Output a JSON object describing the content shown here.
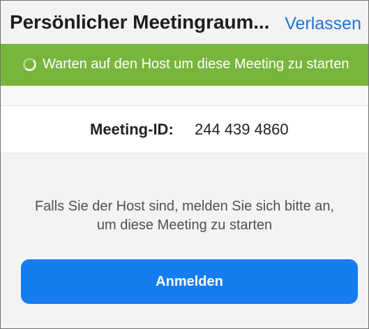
{
  "header": {
    "title": "Persönlicher Meetingraum...",
    "leave_label": "Verlassen"
  },
  "status_banner": {
    "icon": "loading-spinner-icon",
    "text": "Warten auf den Host um diese Meeting zu starten",
    "background_color": "#78b53d"
  },
  "meeting": {
    "label": "Meeting-ID:",
    "id": "244 439 4860"
  },
  "login_prompt": {
    "line_1": "Falls Sie der Host sind, melden Sie sich bitte an,",
    "line_2": "um diese Meeting zu starten",
    "button_label": "Anmelden",
    "button_color": "#167df0"
  },
  "colors": {
    "link": "#1f73d6",
    "page_background": "#f3f3f3",
    "surface": "#ffffff"
  }
}
